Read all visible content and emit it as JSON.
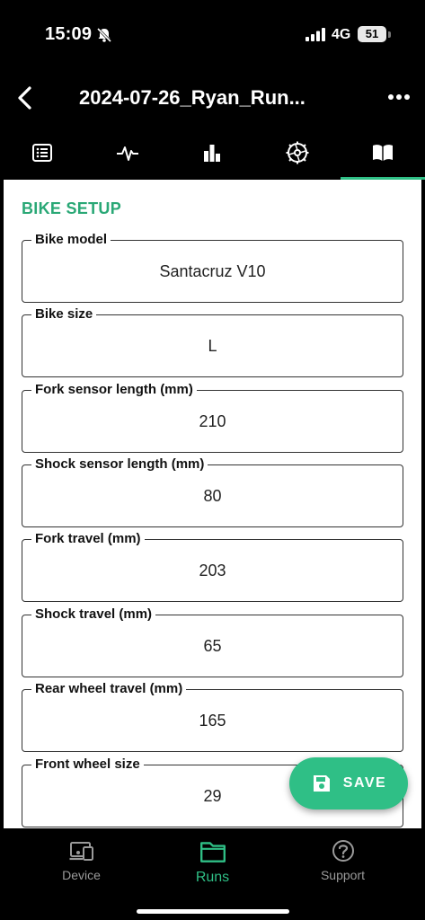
{
  "status_bar": {
    "time": "15:09",
    "network": "4G",
    "battery": "51"
  },
  "header": {
    "title": "2024-07-26_Ryan_Run..."
  },
  "tabs": [
    {
      "name": "details",
      "icon": "list-icon"
    },
    {
      "name": "pulse",
      "icon": "pulse-icon"
    },
    {
      "name": "stats",
      "icon": "bar-chart-icon"
    },
    {
      "name": "setup",
      "icon": "cog-icon"
    },
    {
      "name": "book",
      "icon": "book-icon"
    }
  ],
  "colors": {
    "accent": "#2fbf86",
    "title_green": "#2aa876"
  },
  "section": {
    "title": "BIKE SETUP"
  },
  "fields": [
    {
      "label": "Bike model",
      "value": "Santacruz V10"
    },
    {
      "label": "Bike size",
      "value": "L"
    },
    {
      "label": "Fork sensor length (mm)",
      "value": "210"
    },
    {
      "label": "Shock sensor length (mm)",
      "value": "80"
    },
    {
      "label": "Fork travel (mm)",
      "value": "203"
    },
    {
      "label": "Shock travel (mm)",
      "value": "65"
    },
    {
      "label": "Rear wheel travel (mm)",
      "value": "165"
    },
    {
      "label": "Front wheel size",
      "value": "29"
    }
  ],
  "save": {
    "label": "SAVE"
  },
  "bottom_nav": [
    {
      "label": "Device",
      "icon": "devices-icon"
    },
    {
      "label": "Runs",
      "icon": "folder-icon"
    },
    {
      "label": "Support",
      "icon": "help-circle-icon"
    }
  ]
}
